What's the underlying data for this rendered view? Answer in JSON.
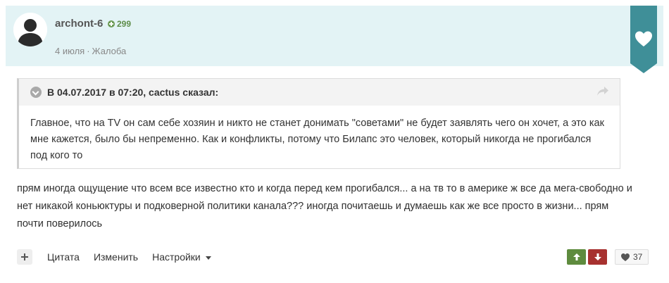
{
  "post": {
    "author": "archont-6",
    "reputation": "299",
    "date": "4 июля",
    "separator": "·",
    "report_label": "Жалоба"
  },
  "quote": {
    "title": "В 04.07.2017 в 07:20, cactus сказал:",
    "text": "Главное, что на TV он сам себе хозяин и никто не станет донимать \"советами\" не будет заявлять чего он хочет, а это как мне кажется, было бы непременно. Как и конфликты, потому что Билапс это человек, который никогда не прогибался под кого то"
  },
  "comment": {
    "text": "прям иногда ощущение что всем все известно кто и когда перед кем прогибался... а на тв то в америке ж все да мега-свободно и нет никакой коньюктуры и подковерной политики канала??? иногда почитаешь и думаешь как же все просто в жизни... прям почти поверилось"
  },
  "actions": {
    "quote_label": "Цитата",
    "edit_label": "Изменить",
    "settings_label": "Настройки"
  },
  "reactions": {
    "likes_count": "37"
  },
  "colors": {
    "header_bg": "#e3f3f5",
    "ribbon": "#3f8f98",
    "vote_up": "#5e8b3e",
    "vote_down": "#a7312f",
    "reputation": "#5e8d4a"
  },
  "icons": [
    "avatar-placeholder",
    "reputation-plus-icon",
    "heart-icon",
    "collapse-icon",
    "share-icon",
    "plus-icon",
    "caret-down-icon",
    "arrow-up-icon",
    "arrow-down-icon"
  ]
}
